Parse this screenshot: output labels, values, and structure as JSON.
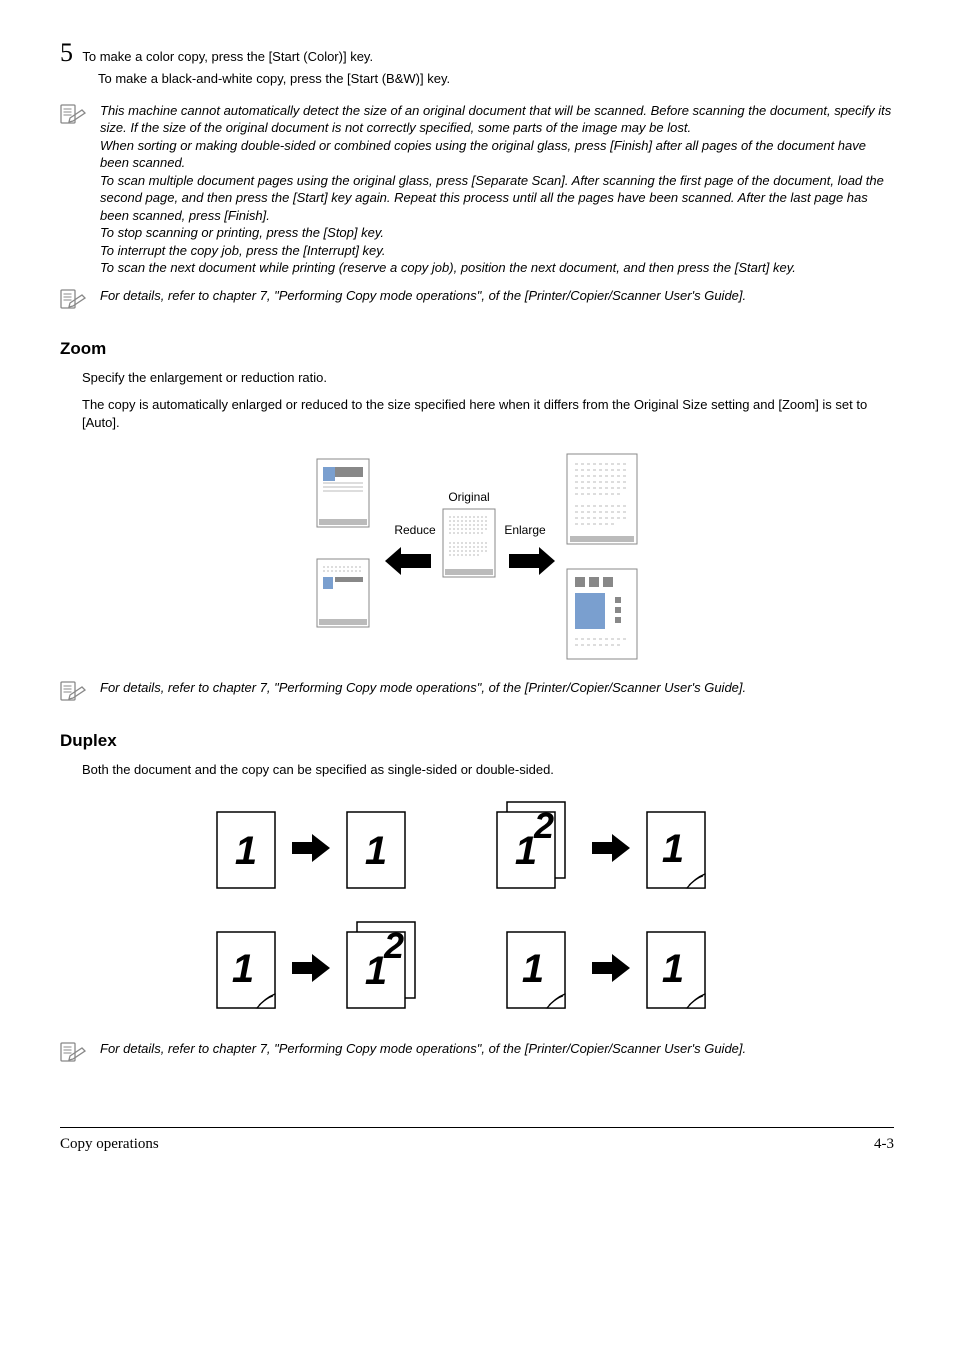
{
  "step": {
    "number": "5",
    "line1": "To make a color copy, press the [Start (Color)] key.",
    "line2": "To make a black-and-white copy, press the [Start (B&W)] key."
  },
  "note1": {
    "p1": "This machine cannot automatically detect the size of an original document that will be scanned. Before scanning the document, specify its size. If the size of the original document is not correctly specified, some parts of the image may be lost.",
    "p2": "When sorting or making double-sided or combined copies using the original glass, press [Finish] after all pages of the document have been scanned.",
    "p3": "To scan multiple document pages using the original glass, press [Separate Scan]. After scanning the first page of the document, load the second page, and then press the [Start] key again. Repeat this process until all the pages have been scanned. After the last page has been scanned, press [Finish].",
    "p4": "To stop scanning or printing, press the [Stop] key.",
    "p5": "To interrupt the copy job, press the [Interrupt] key.",
    "p6": "To scan the next document while printing (reserve a copy job), position the next document, and then press the [Start] key."
  },
  "note2": "For details, refer to chapter 7, \"Performing Copy mode operations\", of the [Printer/Copier/Scanner User's Guide].",
  "zoom": {
    "heading": "Zoom",
    "p1": "Specify the enlargement or reduction ratio.",
    "p2": "The copy is automatically enlarged or reduced to the size specified here when it differs from the Original Size setting and [Zoom] is set to [Auto].",
    "diagram": {
      "original": "Original",
      "reduce": "Reduce",
      "enlarge": "Enlarge"
    }
  },
  "note3": "For details, refer to chapter 7, \"Performing Copy mode operations\", of the [Printer/Copier/Scanner User's Guide].",
  "duplex": {
    "heading": "Duplex",
    "p1": "Both the document and the copy can be specified as single-sided or double-sided."
  },
  "note4": "For details, refer to chapter 7, \"Performing Copy mode operations\", of the [Printer/Copier/Scanner User's Guide].",
  "footer": {
    "left": "Copy operations",
    "right": "4-3"
  }
}
